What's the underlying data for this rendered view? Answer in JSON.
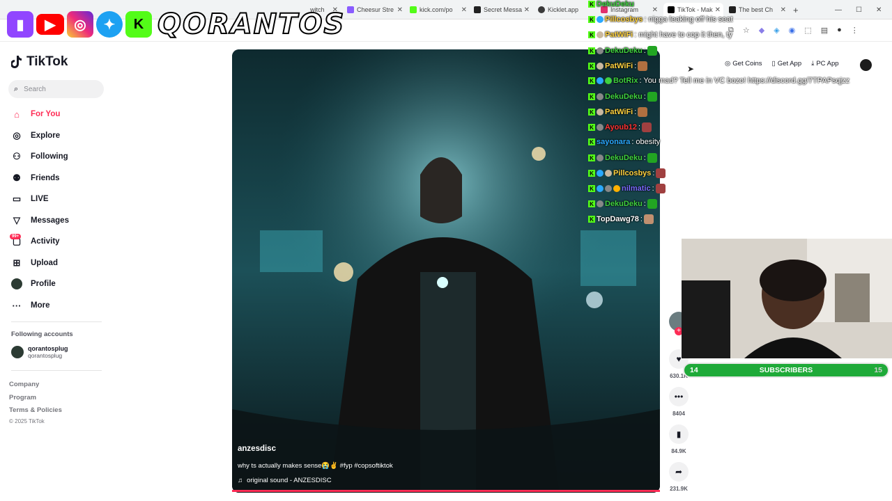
{
  "browser": {
    "tabs": [
      {
        "label": "witch",
        "color": "#9146ff"
      },
      {
        "label": "Cheesur Stre",
        "color": "#8a5cff"
      },
      {
        "label": "kick.com/po",
        "color": "#53fc18"
      },
      {
        "label": "Secret Messa",
        "color": "#222222"
      },
      {
        "label": "Kicklet.app",
        "color": "#3a3a3a"
      },
      {
        "label": "Instagram",
        "color": "#e1306c"
      },
      {
        "label": "TikTok - Mak",
        "color": "#000000"
      },
      {
        "label": "The best Ch",
        "color": "#202020"
      }
    ],
    "new_tab": "+"
  },
  "overlay": {
    "brand_name": "QORANTOS",
    "socials": [
      "twitch",
      "youtube",
      "instagram",
      "twitter",
      "kick"
    ]
  },
  "sidebar": {
    "logo": "TikTok",
    "search_placeholder": "Search",
    "nav": [
      {
        "label": "For You",
        "icon": "home-icon",
        "active": true
      },
      {
        "label": "Explore",
        "icon": "compass-icon"
      },
      {
        "label": "Following",
        "icon": "following-icon"
      },
      {
        "label": "Friends",
        "icon": "friends-icon"
      },
      {
        "label": "LIVE",
        "icon": "live-icon"
      },
      {
        "label": "Messages",
        "icon": "messages-icon"
      },
      {
        "label": "Activity",
        "icon": "activity-icon",
        "badge": "99+"
      },
      {
        "label": "Upload",
        "icon": "upload-icon"
      },
      {
        "label": "Profile",
        "icon": "profile-avatar"
      },
      {
        "label": "More",
        "icon": "more-icon"
      }
    ],
    "following_header": "Following accounts",
    "following_accounts": [
      {
        "name": "qorantosplug",
        "handle": "qorantosplug"
      }
    ],
    "footer": [
      "Company",
      "Program",
      "Terms & Policies"
    ],
    "copyright": "© 2025 TikTok"
  },
  "video": {
    "author": "anzesdisc",
    "caption": "why ts actually makes sense😭✌️ #fyp #copsoftiktok",
    "sound": "original sound - ANZESDISC"
  },
  "actions": {
    "likes": "630.1K",
    "comments": "8404",
    "saves": "84.9K",
    "shares": "231.9K"
  },
  "header_links": {
    "coins": "Get Coins",
    "app": "Get App",
    "pc": "PC App"
  },
  "chat": [
    {
      "user": "DekuDeku",
      "color": "#3fd13f",
      "msg": ""
    },
    {
      "user": "Pillcosbys",
      "color": "#ffd23f",
      "msg": ": nigga leaking off his seat"
    },
    {
      "user": "PatWiFi",
      "color": "#ffd23f",
      "msg": ": might have to cop it then, ty"
    },
    {
      "user": "DekuDeku",
      "color": "#3fd13f",
      "msg": ":"
    },
    {
      "user": "PatWiFi",
      "color": "#ffd23f",
      "msg": ":"
    },
    {
      "user": "BotRix",
      "color": "#3fd13f",
      "msg": ": You mad? Tell me in VC bozo! https://discord.gg/7TPAPsqjzz"
    },
    {
      "user": "DekuDeku",
      "color": "#3fd13f",
      "msg": ":"
    },
    {
      "user": "PatWiFi",
      "color": "#ffd23f",
      "msg": ":"
    },
    {
      "user": "Ayoub12",
      "color": "#ff3333",
      "msg": ":"
    },
    {
      "user": "sayonara",
      "color": "#2aa9ff",
      "msg": ": obesity"
    },
    {
      "user": "DekuDeku",
      "color": "#3fd13f",
      "msg": ":"
    },
    {
      "user": "Pillcosbys",
      "color": "#ffd23f",
      "msg": ":"
    },
    {
      "user": "nilmatic",
      "color": "#7b6bff",
      "msg": ":"
    },
    {
      "user": "DekuDeku",
      "color": "#3fd13f",
      "msg": ":"
    },
    {
      "user": "TopDawg78",
      "color": "#ffffff",
      "msg": ":"
    }
  ],
  "subscribers": {
    "label": "SUBSCRIBERS",
    "current": "14",
    "goal": "15",
    "progress": 0.93
  }
}
